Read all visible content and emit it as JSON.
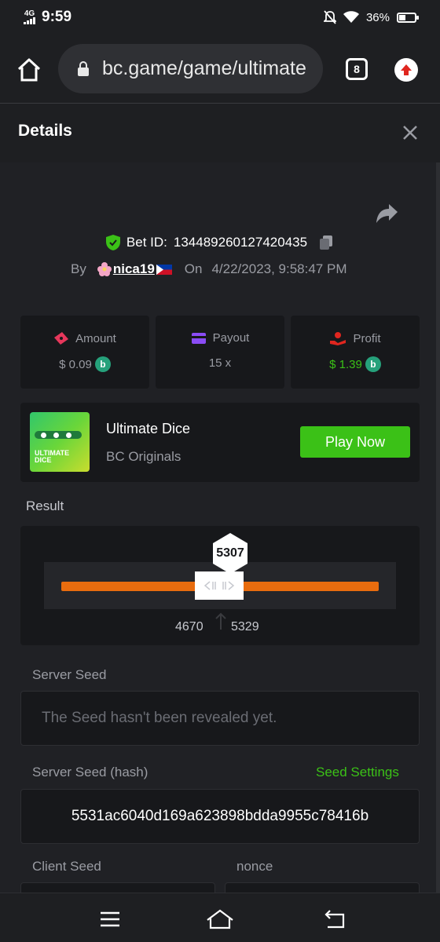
{
  "status": {
    "network": "4G",
    "time": "9:59",
    "battery": "36%"
  },
  "browser": {
    "url": "bc.game/game/ultimate",
    "tab_count": "8"
  },
  "details": {
    "title": "Details",
    "bet_id_label": "Bet ID:",
    "bet_id": "134489260127420435",
    "by_label": "By",
    "username": "nica19",
    "on_label": "On",
    "datetime": "4/22/2023, 9:58:47 PM"
  },
  "stats": {
    "amount_label": "Amount",
    "amount_value": "$ 0.09",
    "payout_label": "Payout",
    "payout_value": "15 x",
    "profit_label": "Profit",
    "profit_value": "$ 1.39"
  },
  "game": {
    "title": "Ultimate Dice",
    "subtitle": "BC Originals",
    "play_label": "Play Now",
    "thumb_text_1": "ULTIMATE",
    "thumb_text_2": "DICE"
  },
  "result": {
    "label": "Result",
    "value": "5307",
    "range_low": "4670",
    "range_high": "5329"
  },
  "seeds": {
    "server_seed_label": "Server Seed",
    "server_seed_value": "The Seed hasn't been revealed yet.",
    "hash_label": "Server Seed (hash)",
    "seed_settings_label": "Seed Settings",
    "hash_value": "5531ac6040d169a623898bdda9955c78416b",
    "client_seed_label": "Client Seed",
    "nonce_label": "nonce"
  },
  "colors": {
    "accent_green": "#3bc117",
    "slider_orange": "#e86c0e",
    "panel_dark": "#17181b"
  }
}
